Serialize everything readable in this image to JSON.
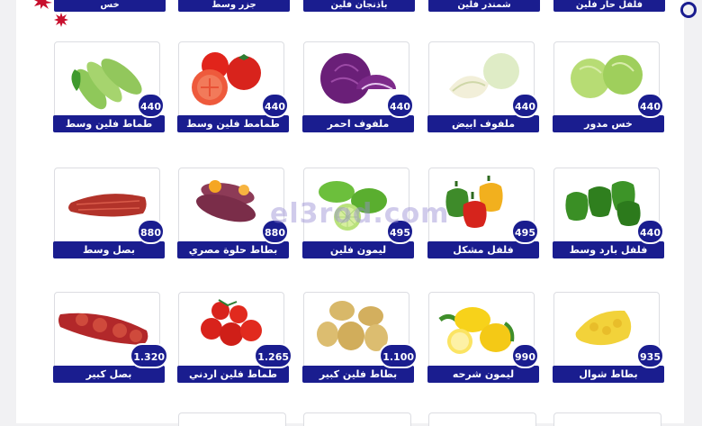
{
  "watermark": "el3rod.com",
  "top_row": [
    "خس",
    "جزر وسط",
    "باذنجان فلين",
    "شمندر فلين",
    "فلفل حار فلين"
  ],
  "rows": [
    [
      {
        "name": "طماط فلين وسط",
        "price": "440",
        "icon": "zucchini-image"
      },
      {
        "name": "طمامط فلين وسط",
        "price": "440",
        "icon": "tomato-image"
      },
      {
        "name": "ملفوف احمر",
        "price": "440",
        "icon": "red-cabbage-image"
      },
      {
        "name": "ملفوف ابيض",
        "price": "440",
        "icon": "white-cabbage-image"
      },
      {
        "name": "خس مدور",
        "price": "440",
        "icon": "lettuce-image"
      }
    ],
    [
      {
        "name": "بصل وسط",
        "price": "880",
        "icon": "onion-sack-image"
      },
      {
        "name": "بطاط حلوة مصري",
        "price": "880",
        "icon": "sweet-potato-image"
      },
      {
        "name": "ليمون فلين",
        "price": "495",
        "icon": "lime-image"
      },
      {
        "name": "فلفل مشكل",
        "price": "495",
        "icon": "mixed-pepper-image"
      },
      {
        "name": "فلفل بارد وسط",
        "price": "440",
        "icon": "green-pepper-image"
      }
    ],
    [
      {
        "name": "بصل كبير",
        "price": "1.320",
        "icon": "onion-net-image"
      },
      {
        "name": "طماط فلين اردني",
        "price": "1.265",
        "icon": "tomato-cluster-image"
      },
      {
        "name": "بطاط فلين كبير",
        "price": "1.100",
        "icon": "potato-image"
      },
      {
        "name": "ليمون شرحه",
        "price": "990",
        "icon": "lemon-image"
      },
      {
        "name": "بطاط شوال",
        "price": "935",
        "icon": "potato-sack-image"
      }
    ]
  ],
  "colors": {
    "accent": "#1a1d8f",
    "burst": "#c8102e"
  }
}
